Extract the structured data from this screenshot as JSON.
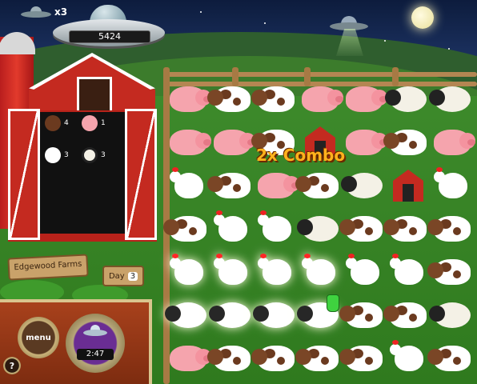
{
  "hud": {
    "lives": "x3",
    "score": "5424",
    "timer": "2:47",
    "menu_label": "menu",
    "help_label": "?"
  },
  "farm": {
    "name": "Edgewood Farms",
    "day_label": "Day",
    "day_number": "3"
  },
  "barn_tally": [
    {
      "animal": "cow",
      "count": "4"
    },
    {
      "animal": "pig",
      "count": "1"
    },
    {
      "animal": "chicken",
      "count": "3"
    },
    {
      "animal": "sheep",
      "count": "3"
    }
  ],
  "combo_text": "2x Combo",
  "board": [
    [
      "pig",
      "cow",
      "cow",
      "pig",
      "pig",
      "sheep",
      "sheep"
    ],
    [
      "pig",
      "pig",
      "cow",
      "barn",
      "pig",
      "cow",
      "pig"
    ],
    [
      "chicken",
      "cow",
      "pig",
      "cow",
      "sheep",
      "barn",
      "chicken"
    ],
    [
      "cow",
      "chicken",
      "chicken",
      "sheep",
      "cow",
      "cow",
      "cow"
    ],
    [
      "chicken",
      "chicken",
      "chicken",
      "chicken",
      "chicken",
      "chicken",
      "cow"
    ],
    [
      "sheep",
      "sheep",
      "sheep",
      "sheep",
      "cow",
      "cow",
      "sheep"
    ],
    [
      "pig",
      "cow",
      "cow",
      "cow",
      "cow",
      "chicken",
      "cow"
    ]
  ],
  "glowing_cells": [
    [
      4,
      0
    ],
    [
      4,
      1
    ],
    [
      4,
      2
    ],
    [
      4,
      3
    ],
    [
      5,
      0
    ],
    [
      5,
      1
    ],
    [
      5,
      2
    ],
    [
      5,
      3
    ]
  ],
  "colors": {
    "sky": "#1e3566",
    "grass": "#3f8a2a",
    "barn_red": "#c42a20",
    "combo": "#ffb21c"
  }
}
